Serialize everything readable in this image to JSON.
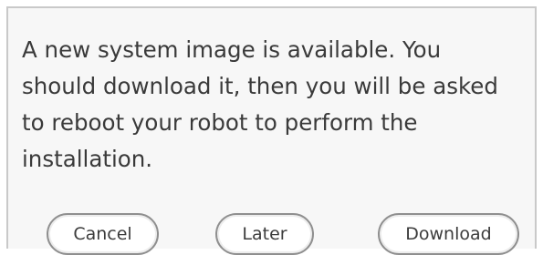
{
  "dialog": {
    "message": "A new system image is available. You should download it, then you will be asked to reboot your robot to perform the installation.",
    "buttons": {
      "cancel": "Cancel",
      "later": "Later",
      "download": "Download"
    }
  }
}
